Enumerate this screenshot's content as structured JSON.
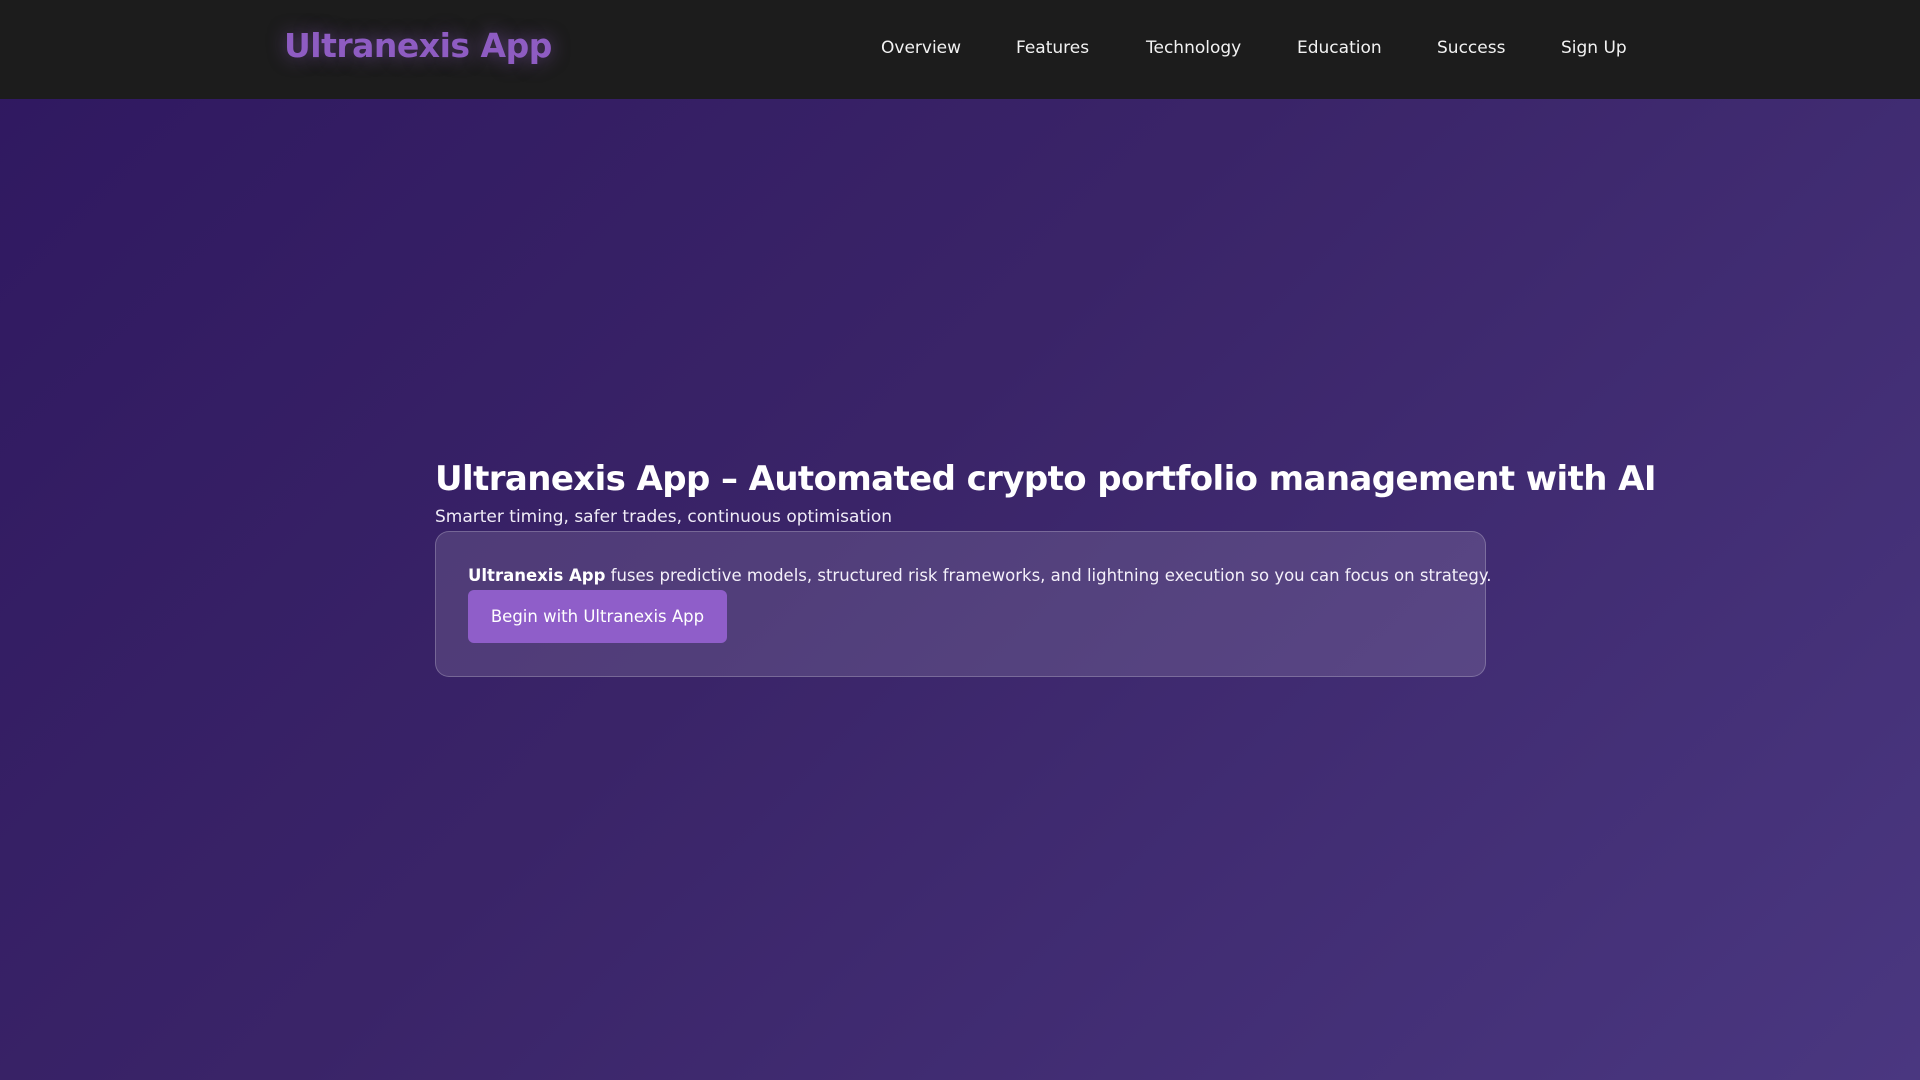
{
  "header": {
    "logo": "Ultranexis App",
    "nav": [
      {
        "label": "Overview"
      },
      {
        "label": "Features"
      },
      {
        "label": "Technology"
      },
      {
        "label": "Education"
      },
      {
        "label": "Success"
      },
      {
        "label": "Sign Up"
      }
    ]
  },
  "hero": {
    "title": "Ultranexis App – Automated crypto portfolio management with AI",
    "subtitle": "Smarter timing, safer trades, continuous optimisation",
    "card": {
      "brand": "Ultranexis App",
      "description": " fuses predictive models, structured risk frameworks, and lightning execution so you can focus on strategy.",
      "cta_label": "Begin with Ultranexis App"
    }
  },
  "colors": {
    "header_bg": "#1c1c1c",
    "logo": "#8e5cc2",
    "page_bg_start": "#2f1860",
    "page_bg_end": "#4a3780",
    "cta_bg": "#8f5ec9"
  }
}
